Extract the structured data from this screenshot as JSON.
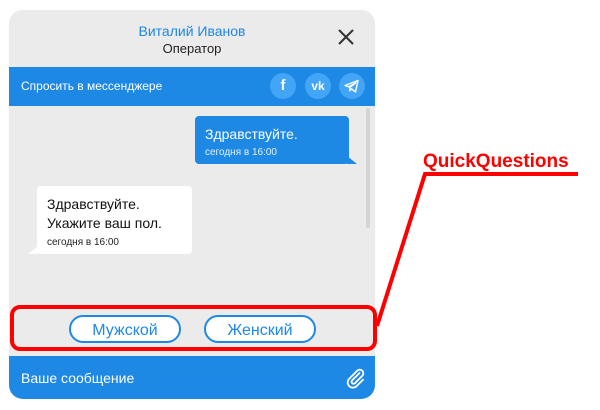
{
  "widget": {
    "operator_name": "Виталий Иванов",
    "operator_role": "Оператор",
    "close_icon": "close-icon"
  },
  "messenger_bar": {
    "label": "Спросить в мессенджере",
    "icons": [
      "facebook-icon",
      "vk-icon",
      "telegram-icon"
    ],
    "facebook_glyph": "f",
    "vk_glyph": "vk"
  },
  "messages": [
    {
      "direction": "outgoing",
      "text": "Здравствуйте.",
      "time": "сегодня в 16:00"
    },
    {
      "direction": "incoming",
      "text_lines": [
        "Здравствуйте.",
        "Укажите ваш пол."
      ],
      "time": "сегодня в 16:00"
    }
  ],
  "quick_questions": {
    "options": [
      "Мужской",
      "Женский"
    ]
  },
  "input_bar": {
    "placeholder": "Ваше сообщение",
    "attach_icon": "paperclip-icon"
  },
  "annotation": {
    "label": "QuickQuestions"
  },
  "colors": {
    "accent": "#1e88e5",
    "panel_background": "#ebebeb",
    "annotation": "#ff0000"
  }
}
